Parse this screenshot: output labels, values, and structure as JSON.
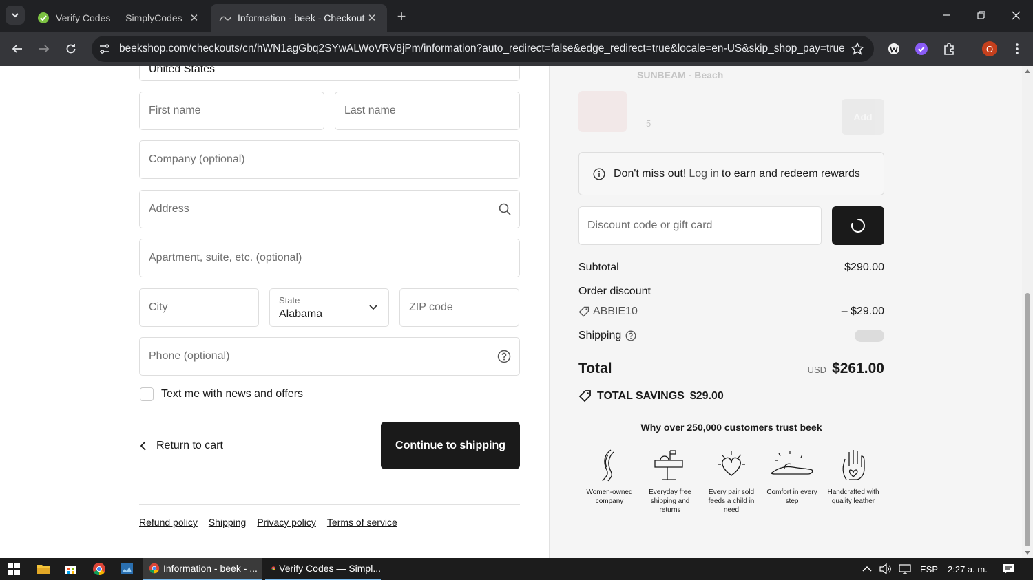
{
  "browser": {
    "tabs": [
      {
        "title": "Verify Codes — SimplyCodes",
        "active": false
      },
      {
        "title": "Information - beek - Checkout",
        "active": true
      }
    ],
    "url": "beekshop.com/checkouts/cn/hWN1agGbq2SYwALWoVRV8jPm/information?auto_redirect=false&edge_redirect=true&locale=en-US&skip_shop_pay=true",
    "profile_initial": "O"
  },
  "form": {
    "country_value": "United States",
    "first_name_placeholder": "First name",
    "last_name_placeholder": "Last name",
    "company_placeholder": "Company (optional)",
    "address_placeholder": "Address",
    "apartment_placeholder": "Apartment, suite, etc. (optional)",
    "city_placeholder": "City",
    "state_label": "State",
    "state_value": "Alabama",
    "zip_placeholder": "ZIP code",
    "phone_placeholder": "Phone (optional)",
    "sms_optin_label": "Text me with news and offers",
    "return_label": "Return to cart",
    "continue_label": "Continue to shipping"
  },
  "footer": {
    "links": [
      "Refund policy",
      "Shipping",
      "Privacy policy",
      "Terms of service"
    ]
  },
  "summary": {
    "faded_product_name": "SUNBEAM - Beach",
    "faded_qty": "5",
    "faded_add_label": "Add",
    "rewards_prefix": "Don't miss out!",
    "rewards_link": "Log in",
    "rewards_suffix": "to earn and redeem rewards",
    "discount_placeholder": "Discount code or gift card",
    "subtotal_label": "Subtotal",
    "subtotal_value": "$290.00",
    "order_discount_label": "Order discount",
    "discount_code": "ABBIE10",
    "discount_value": "– $29.00",
    "shipping_label": "Shipping",
    "total_label": "Total",
    "currency": "USD",
    "total_value": "$261.00",
    "total_savings_label": "TOTAL SAVINGS",
    "total_savings_value": "$29.00",
    "trust_title": "Why over 250,000 customers trust beek",
    "trust_items": [
      {
        "label": "Women-owned company",
        "icon": "hair-icon"
      },
      {
        "label": "Everyday free shipping and returns",
        "icon": "mailbox-icon"
      },
      {
        "label": "Every pair sold feeds a child in need",
        "icon": "heart-icon"
      },
      {
        "label": "Comfort in every step",
        "icon": "sandal-icon"
      },
      {
        "label": "Handcrafted with quality leather",
        "icon": "hand-icon"
      }
    ]
  },
  "taskbar": {
    "apps": [
      "Information - beek - ...",
      "Verify Codes — Simpl..."
    ],
    "language": "ESP",
    "time": "2:27 a. m."
  }
}
